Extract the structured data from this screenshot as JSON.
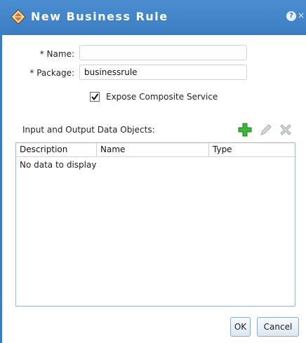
{
  "dialog": {
    "title": "New Business Rule",
    "help_glyph": "?",
    "close_glyph": "×",
    "title_icon": "business-rule-icon"
  },
  "form": {
    "name_label": "* Name:",
    "name_value": "",
    "package_label": "* Package:",
    "package_value": "businessrule",
    "expose_label": "Expose Composite Service",
    "expose_checked": true
  },
  "data_objects": {
    "label": "Input and Output Data Objects:",
    "toolbar": [
      "add-icon",
      "edit-icon",
      "delete-icon"
    ],
    "columns": [
      "Description",
      "Name",
      "Type"
    ],
    "empty_text": "No data to display"
  },
  "buttons": {
    "ok": "OK",
    "cancel": "Cancel"
  },
  "colors": {
    "title_bar": "#3a7cc2",
    "add_icon": "#3bb53b"
  }
}
